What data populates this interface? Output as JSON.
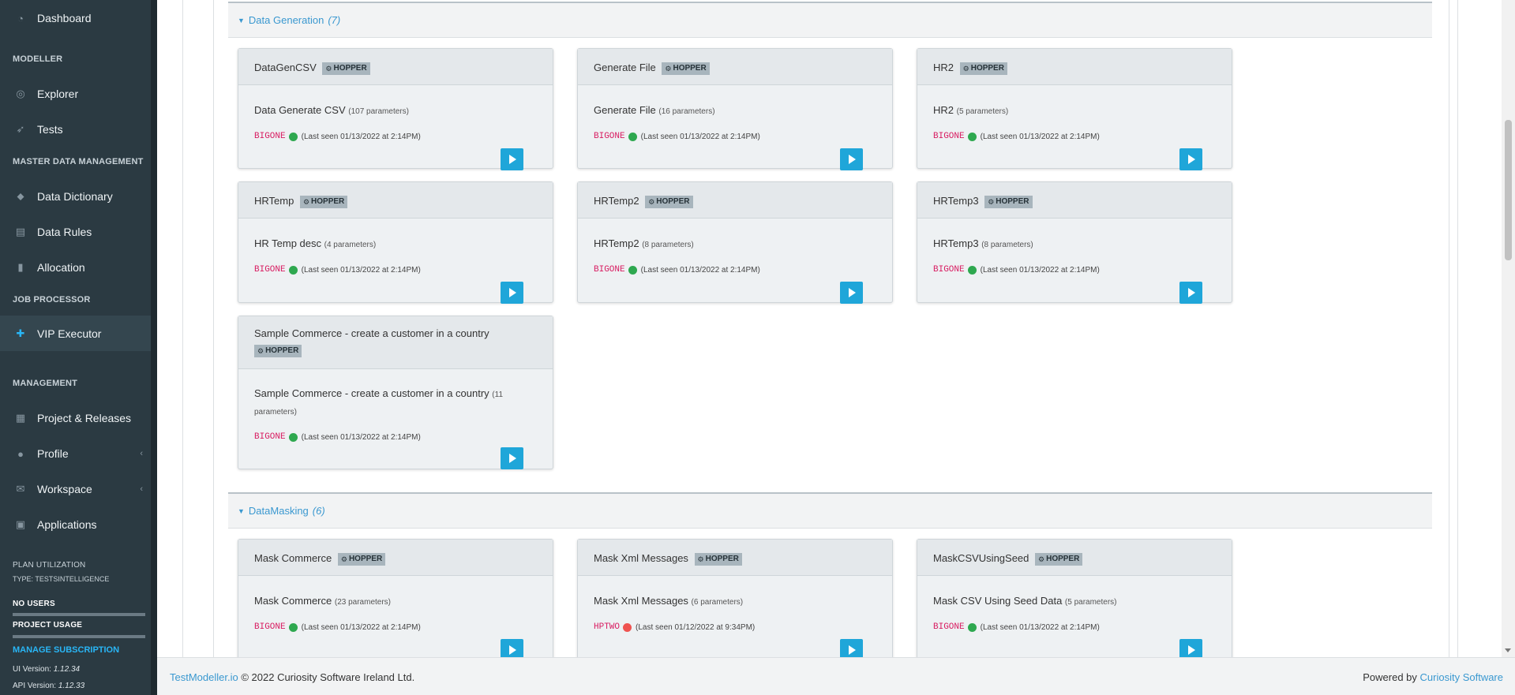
{
  "sidebar": {
    "items": {
      "dashboard": {
        "label": "Dashboard",
        "icon": "dashboard-icon"
      },
      "explorer": {
        "label": "Explorer",
        "icon": "globe-icon"
      },
      "tests": {
        "label": "Tests",
        "icon": "rocket-icon"
      },
      "data_dictionary": {
        "label": "Data Dictionary",
        "icon": "tags-icon"
      },
      "data_rules": {
        "label": "Data Rules",
        "icon": "list-card-icon"
      },
      "allocation": {
        "label": "Allocation",
        "icon": "book-icon"
      },
      "vip_executor": {
        "label": "VIP Executor",
        "icon": "puzzle-icon"
      },
      "project_releases": {
        "label": "Project & Releases",
        "icon": "archive-icon"
      },
      "profile": {
        "label": "Profile",
        "icon": "user-icon"
      },
      "workspace": {
        "label": "Workspace",
        "icon": "inbox-icon"
      },
      "applications": {
        "label": "Applications",
        "icon": "object-group-icon"
      }
    },
    "sections": {
      "modeller": "MODELLER",
      "mdm": "MASTER DATA MANAGEMENT",
      "job_processor": "JOB PROCESSOR",
      "management": "MANAGEMENT"
    },
    "plan": {
      "title": "PLAN UTILIZATION",
      "type": "TYPE: TESTSINTELLIGENCE",
      "no_users": "NO USERS",
      "project_usage": "PROJECT USAGE",
      "manage": "MANAGE SUBSCRIPTION"
    },
    "versions": {
      "ui_label": "UI Version:",
      "ui_value": "1.12.34",
      "api_label": "API Version:",
      "api_value": "1.12.33"
    }
  },
  "groups": [
    {
      "name": "Data Generation",
      "count": "(7)",
      "cards": [
        {
          "title": "DataGenCSV",
          "badge": "HOPPER",
          "desc": "Data Generate CSV",
          "params": "(107 parameters)",
          "agent": "BIGONE",
          "status": "green",
          "seen": "(Last seen 01/13/2022 at 2:14PM)"
        },
        {
          "title": "Generate File",
          "badge": "HOPPER",
          "desc": "Generate File",
          "params": "(16 parameters)",
          "agent": "BIGONE",
          "status": "green",
          "seen": "(Last seen 01/13/2022 at 2:14PM)"
        },
        {
          "title": "HR2",
          "badge": "HOPPER",
          "desc": "HR2",
          "params": "(5 parameters)",
          "agent": "BIGONE",
          "status": "green",
          "seen": "(Last seen 01/13/2022 at 2:14PM)"
        },
        {
          "title": "HRTemp",
          "badge": "HOPPER",
          "desc": "HR Temp desc",
          "params": "(4 parameters)",
          "agent": "BIGONE",
          "status": "green",
          "seen": "(Last seen 01/13/2022 at 2:14PM)"
        },
        {
          "title": "HRTemp2",
          "badge": "HOPPER",
          "desc": "HRTemp2",
          "params": "(8 parameters)",
          "agent": "BIGONE",
          "status": "green",
          "seen": "(Last seen 01/13/2022 at 2:14PM)"
        },
        {
          "title": "HRTemp3",
          "badge": "HOPPER",
          "desc": "HRTemp3",
          "params": "(8 parameters)",
          "agent": "BIGONE",
          "status": "green",
          "seen": "(Last seen 01/13/2022 at 2:14PM)"
        },
        {
          "title": "Sample Commerce - create a customer in a country",
          "badge": "HOPPER",
          "desc": "Sample Commerce - create a customer in a country",
          "params": "(11 parameters)",
          "agent": "BIGONE",
          "status": "green",
          "seen": "(Last seen 01/13/2022 at 2:14PM)"
        }
      ]
    },
    {
      "name": "DataMasking",
      "count": "(6)",
      "cards": [
        {
          "title": "Mask Commerce",
          "badge": "HOPPER",
          "desc": "Mask Commerce",
          "params": "(23 parameters)",
          "agent": "BIGONE",
          "status": "green",
          "seen": "(Last seen 01/13/2022 at 2:14PM)"
        },
        {
          "title": "Mask Xml Messages",
          "badge": "HOPPER",
          "desc": "Mask Xml Messages",
          "params": "(6 parameters)",
          "agent": "HPTWO",
          "status": "red",
          "seen": "(Last seen 01/12/2022 at 9:34PM)"
        },
        {
          "title": "MaskCSVUsingSeed",
          "badge": "HOPPER",
          "desc": "Mask CSV Using Seed Data",
          "params": "(5 parameters)",
          "agent": "BIGONE",
          "status": "green",
          "seen": "(Last seen 01/13/2022 at 2:14PM)"
        }
      ]
    }
  ],
  "footer": {
    "brand": "TestModeller.io",
    "copyright": "© 2022 Curiosity Software Ireland Ltd.",
    "powered": "Powered by",
    "company": "Curiosity Software"
  },
  "colors": {
    "sidebar_bg": "#2b3a42",
    "accent": "#1fa6d9",
    "link": "#3a98d0",
    "agent": "#d81b60",
    "online": "#2ea84f",
    "offline": "#ef5350"
  }
}
